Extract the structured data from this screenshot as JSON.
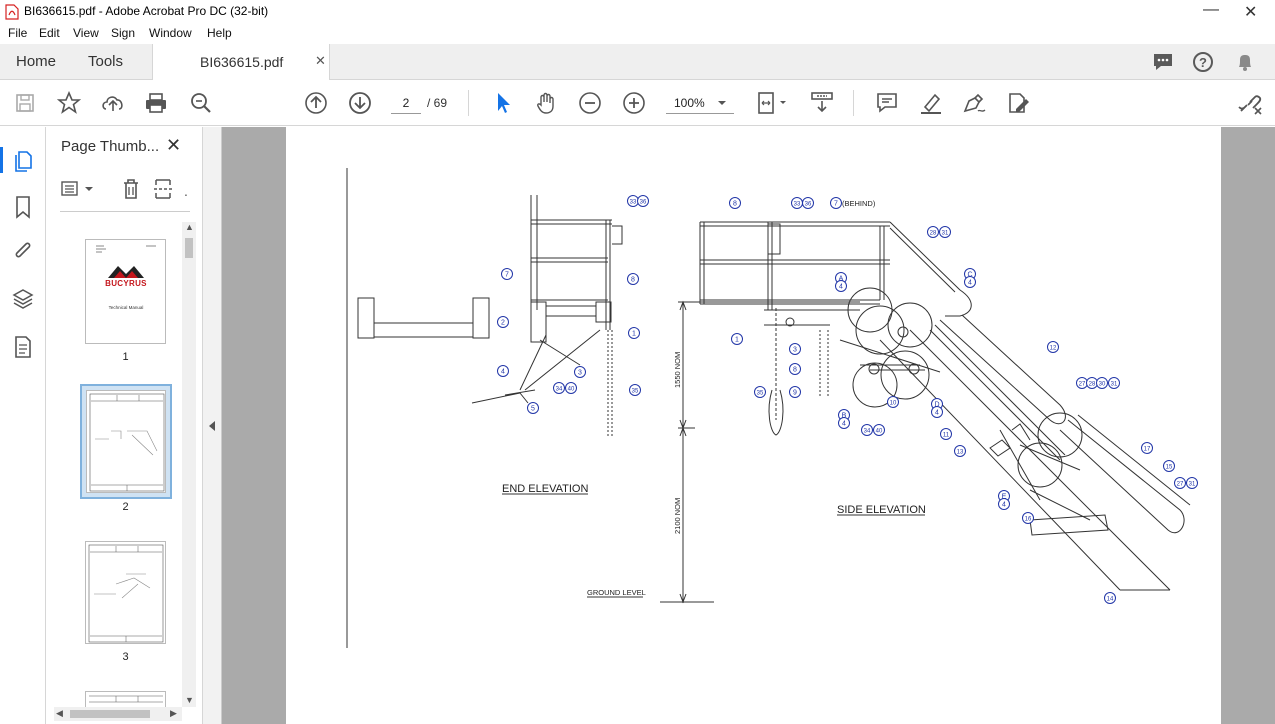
{
  "window": {
    "title": "BI636615.pdf - Adobe Acrobat Pro DC (32-bit)"
  },
  "menu": [
    "File",
    "Edit",
    "View",
    "Sign",
    "Window",
    "Help"
  ],
  "tabs": {
    "home": "Home",
    "tools": "Tools",
    "document": "BI636615.pdf"
  },
  "nav": {
    "current_page": "2",
    "total_pages": "/ 69",
    "zoom": "100%"
  },
  "thumbnails": {
    "panel_title": "Page Thumb...",
    "pages": [
      {
        "label": "1",
        "brand": "BUCYRUS",
        "caption": "Technical Manual"
      },
      {
        "label": "2"
      },
      {
        "label": "3"
      }
    ]
  },
  "drawing": {
    "end_elevation": "END ELEVATION",
    "side_elevation": "SIDE ELEVATION",
    "ground_level": "GROUND LEVEL",
    "dim_1550": "1550 NOM",
    "dim_2100": "2100 NOM",
    "behind": "(BEHIND)",
    "callouts": [
      "33",
      "36",
      "7",
      "8",
      "2",
      "1",
      "3",
      "4",
      "5",
      "34",
      "40",
      "35",
      "8",
      "33",
      "36",
      "7",
      "28",
      "31",
      "A",
      "4",
      "C",
      "4",
      "12",
      "1",
      "3",
      "8",
      "9",
      "35",
      "10",
      "B",
      "4",
      "D",
      "4",
      "34",
      "40",
      "11",
      "13",
      "27",
      "28",
      "30",
      "31",
      "17",
      "15",
      "27",
      "31",
      "E",
      "4",
      "16",
      "14"
    ]
  },
  "colors": {
    "accent": "#1473e6",
    "pdf_red": "#d62222",
    "callout_blue": "#2236a8",
    "drawing_line": "#333333"
  }
}
